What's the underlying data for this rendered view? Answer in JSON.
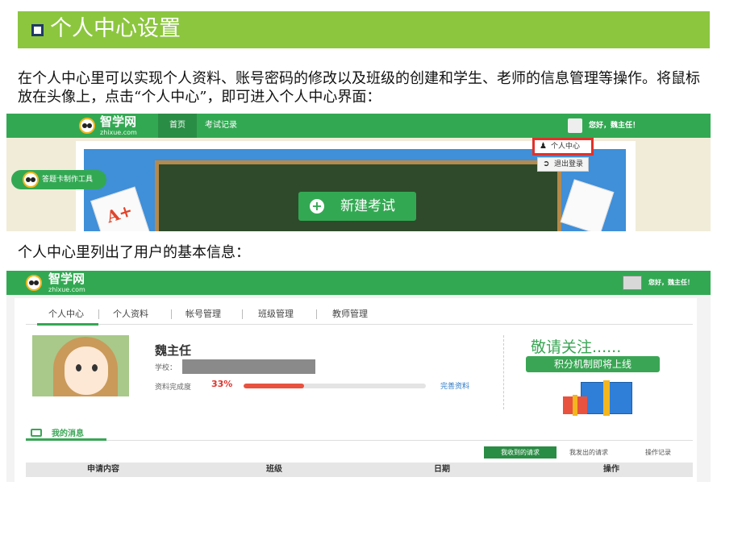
{
  "slide": {
    "title": "个人中心设置",
    "intro": "在个人中心里可以实现个人资料、账号密码的修改以及班级的创建和学生、老师的信息管理等操作。将鼠标放在头像上，点击“个人中心”，即可进入个人中心界面：",
    "intro2": "个人中心里列出了用户的基本信息：",
    "accent_color": "#8cc63f"
  },
  "shot1": {
    "logo": "智学网",
    "logo_sub": "zhixue.com",
    "nav": [
      "首页",
      "考试记录"
    ],
    "greeting": "您好，魏主任！",
    "menu": [
      {
        "icon": "user-icon",
        "label": "个人中心"
      },
      {
        "icon": "logout-icon",
        "label": "退出登录"
      }
    ],
    "new_exam": "新建考试",
    "card_tool": "答题卡制作工具",
    "paper_mark": "A+",
    "brand_color": "#33a853",
    "highlight_color": "#e0312a"
  },
  "shot2": {
    "logo": "智学网",
    "logo_sub": "zhixue.com",
    "greeting": "您好，魏主任！",
    "tabs": [
      "个人中心",
      "个人资料",
      "帐号管理",
      "班级管理",
      "教师管理"
    ],
    "active_tab": "个人中心",
    "profile": {
      "name": "魏主任",
      "school_label": "学校：",
      "completion_label": "资料完成度",
      "completion_pct": "33%",
      "completion_value": 0.33,
      "complete_link": "完善资料"
    },
    "promo": {
      "headline": "敬请关注......",
      "sub": "积分机制即将上线"
    },
    "messages": {
      "title": "我的消息",
      "subtabs": [
        "我收到的请求",
        "我发出的请求",
        "操作记录"
      ],
      "columns": [
        "申请内容",
        "班级",
        "日期",
        "操作"
      ]
    }
  }
}
